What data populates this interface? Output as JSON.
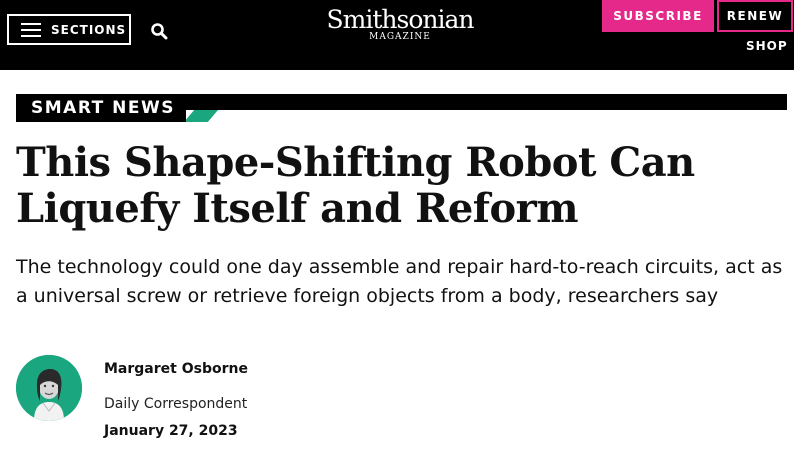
{
  "header": {
    "sections_label": "SECTIONS",
    "logo_main": "Smithsonian",
    "logo_sub": "MAGAZINE",
    "subscribe_label": "SUBSCRIBE",
    "renew_label": "RENEW",
    "shop_label": "SHOP",
    "icons": [
      "hamburger-icon",
      "search-icon"
    ]
  },
  "article": {
    "section_label": "SMART NEWS",
    "headline": "This Shape-Shifting Robot Can Liquefy Itself and Reform",
    "dek": "The technology could one day assemble and repair hard-to-reach circuits, act as a universal screw or retrieve foreign objects from a body, researchers say",
    "author": {
      "name": "Margaret Osborne",
      "title": "Daily Correspondent"
    },
    "date": "January 27, 2023"
  },
  "colors": {
    "brand_black": "#000000",
    "subscribe_pink": "#e5298a",
    "accent_green": "#1aa67e"
  }
}
